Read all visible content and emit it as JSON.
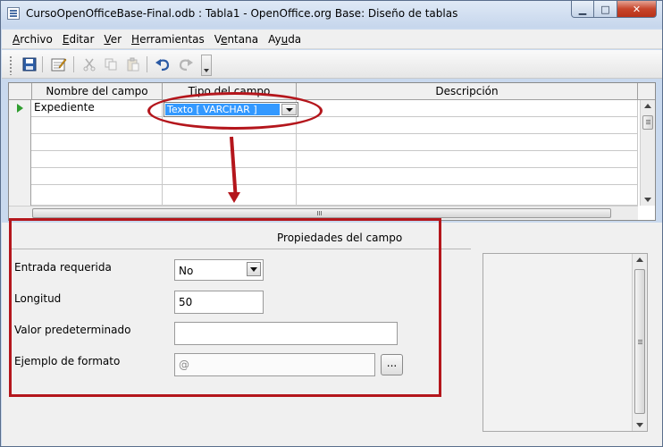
{
  "window": {
    "title": "CursoOpenOfficeBase-Final.odb : Tabla1 - OpenOffice.org Base: Diseño de tablas",
    "min_glyph": "▁",
    "max_glyph": "□",
    "close_glyph": "✕"
  },
  "menu": {
    "items": [
      {
        "pre": "",
        "key": "A",
        "post": "rchivo"
      },
      {
        "pre": "",
        "key": "E",
        "post": "ditar"
      },
      {
        "pre": "",
        "key": "V",
        "post": "er"
      },
      {
        "pre": "",
        "key": "H",
        "post": "erramientas"
      },
      {
        "pre": "V",
        "key": "e",
        "post": "ntana"
      },
      {
        "pre": "Ay",
        "key": "u",
        "post": "da"
      }
    ]
  },
  "toolbar": {
    "icons": [
      "save-icon",
      "edit-index-icon",
      "cut-icon",
      "copy-icon",
      "paste-icon",
      "undo-icon",
      "redo-icon"
    ]
  },
  "table": {
    "columns": [
      "Nombre del campo",
      "Tipo del campo",
      "Descripción"
    ],
    "rows": [
      {
        "name": "Expediente",
        "type": "Texto [ VARCHAR ]",
        "description": ""
      },
      {
        "name": "",
        "type": "",
        "description": ""
      },
      {
        "name": "",
        "type": "",
        "description": ""
      },
      {
        "name": "",
        "type": "",
        "description": ""
      },
      {
        "name": "",
        "type": "",
        "description": ""
      },
      {
        "name": "",
        "type": "",
        "description": ""
      }
    ]
  },
  "properties": {
    "title": "Propiedades del campo",
    "required_label": "Entrada requerida",
    "required_value": "No",
    "length_label": "Longitud",
    "length_value": "50",
    "default_label": "Valor predeterminado",
    "default_value": "",
    "format_label": "Ejemplo de formato",
    "format_value": "@",
    "format_button": "..."
  },
  "annotation_color": "#b4161c"
}
